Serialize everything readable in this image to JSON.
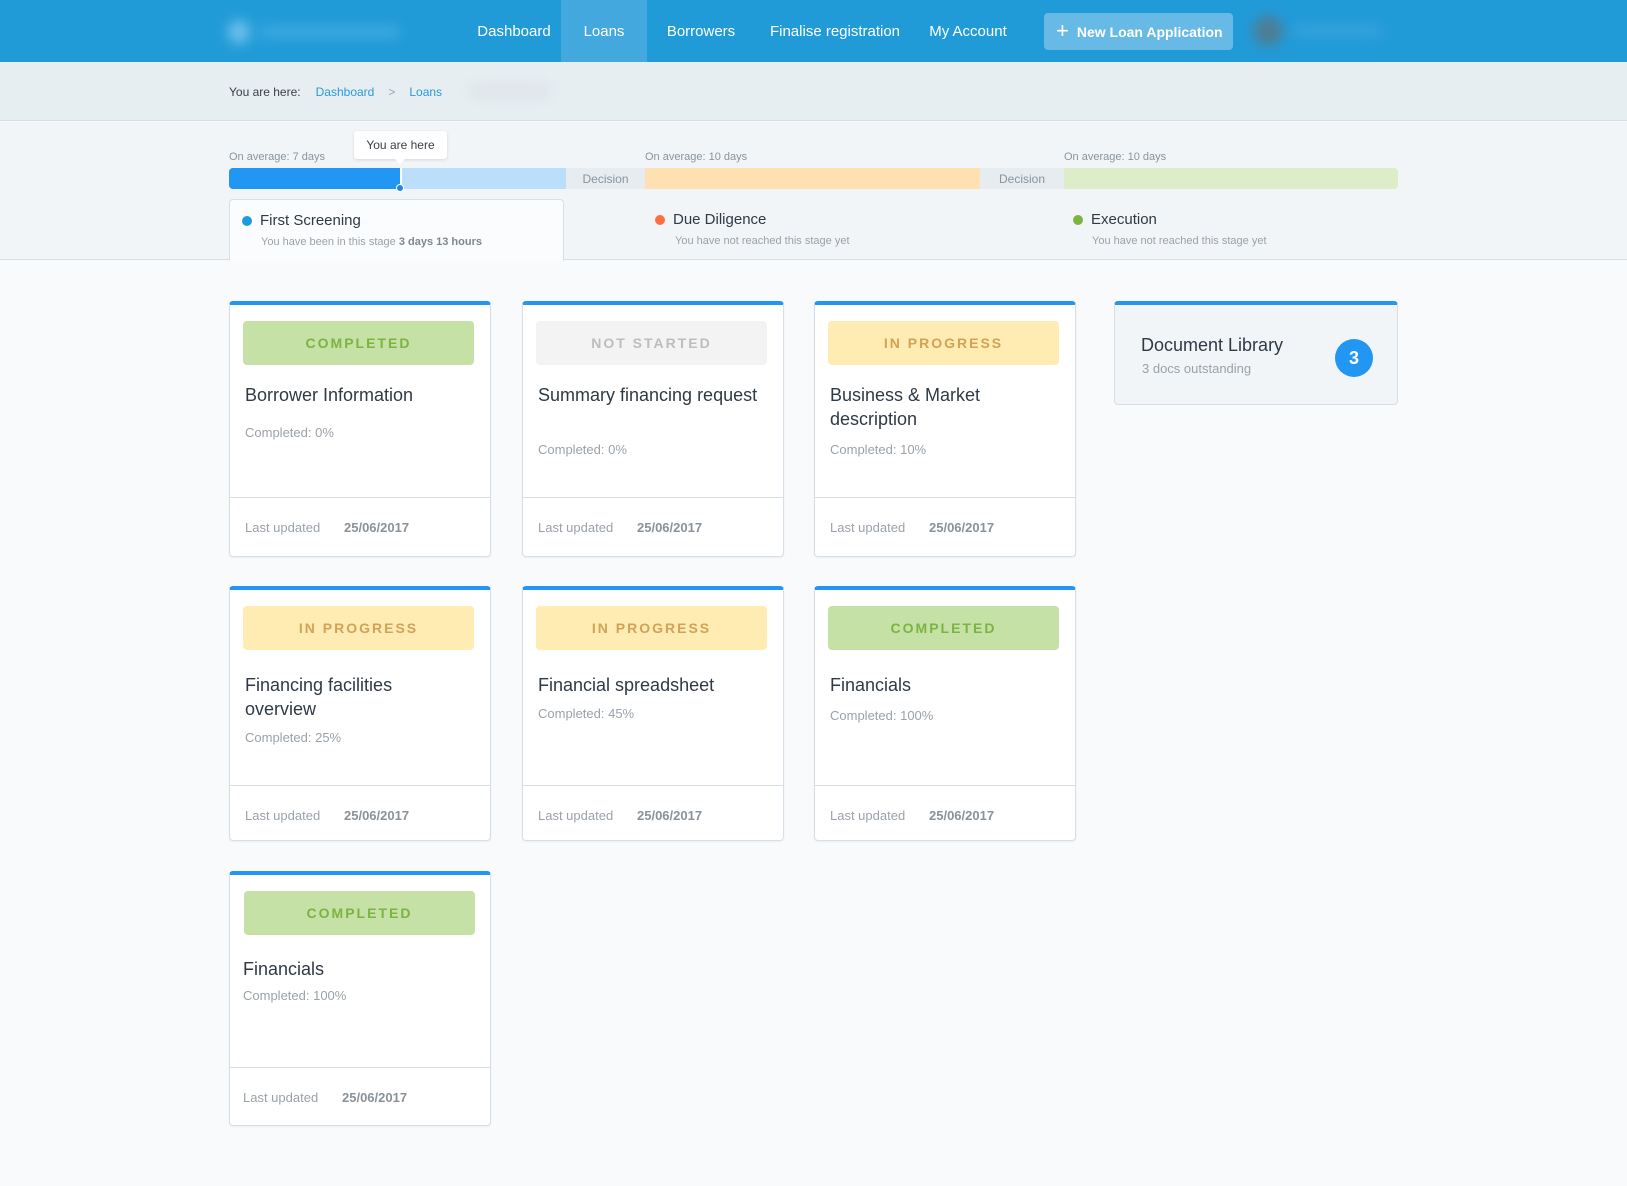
{
  "nav": {
    "items": [
      {
        "label": "Dashboard",
        "active": false
      },
      {
        "label": "Loans",
        "active": true
      },
      {
        "label": "Borrowers",
        "active": false
      },
      {
        "label": "Finalise registration",
        "active": false
      },
      {
        "label": "My Account",
        "active": false
      }
    ],
    "new_button": {
      "icon": "plus-icon",
      "label": "New Loan Application"
    }
  },
  "breadcrumb": {
    "prefix": "You are here:",
    "items": [
      "Dashboard",
      "Loans"
    ],
    "separator": ">"
  },
  "progress": {
    "tooltip": "You are here",
    "current_stage_progress_fraction": 0.51,
    "segments": [
      {
        "avg": "On average: 7 days",
        "color": "#2196f3"
      },
      {
        "decision": "Decision"
      },
      {
        "avg": "On average: 10 days",
        "color": "#ffe0b2"
      },
      {
        "decision": "Decision"
      },
      {
        "avg": "On average: 10 days",
        "color": "#dcedc8"
      }
    ],
    "stages": [
      {
        "title": "First Screening",
        "dot_color": "#1e9be0",
        "sub_prefix": "You have been in this stage",
        "sub_bold": "3 days 13 hours",
        "current": true
      },
      {
        "title": "Due Diligence",
        "dot_color": "#ff6e40",
        "sub": "You have not reached this stage yet",
        "current": false
      },
      {
        "title": "Execution",
        "dot_color": "#7cb342",
        "sub": "You have not reached this stage yet",
        "current": false
      }
    ]
  },
  "cards": [
    {
      "status": "COMPLETED",
      "title": "Borrower Information",
      "completed": "Completed: 0%",
      "updated_label": "Last updated",
      "updated": "25/06/2017"
    },
    {
      "status": "NOT STARTED",
      "title": "Summary financing request",
      "completed": "Completed: 0%",
      "updated_label": "Last updated",
      "updated": "25/06/2017"
    },
    {
      "status": "IN PROGRESS",
      "title": "Business & Market description",
      "completed": "Completed: 10%",
      "updated_label": "Last updated",
      "updated": "25/06/2017"
    },
    {
      "status": "IN PROGRESS",
      "title": "Financing facilities overview",
      "completed": "Completed: 25%",
      "updated_label": "Last updated",
      "updated": "25/06/2017"
    },
    {
      "status": "IN PROGRESS",
      "title": "Financial spreadsheet",
      "completed": "Completed: 45%",
      "updated_label": "Last updated",
      "updated": "25/06/2017"
    },
    {
      "status": "COMPLETED",
      "title": "Financials",
      "completed": "Completed: 100%",
      "updated_label": "Last updated",
      "updated": "25/06/2017"
    },
    {
      "status": "COMPLETED",
      "title": "Financials",
      "completed": "Completed: 100%",
      "updated_label": "Last updated",
      "updated": "25/06/2017"
    }
  ],
  "document_library": {
    "title": "Document Library",
    "subtitle": "3 docs outstanding",
    "count": "3"
  },
  "colors": {
    "brand": "#219bd8",
    "accent": "#2196f3",
    "completed_bg": "#c5e1a5",
    "in_progress_bg": "#ffecb3",
    "not_started_bg": "#f3f3f3"
  }
}
